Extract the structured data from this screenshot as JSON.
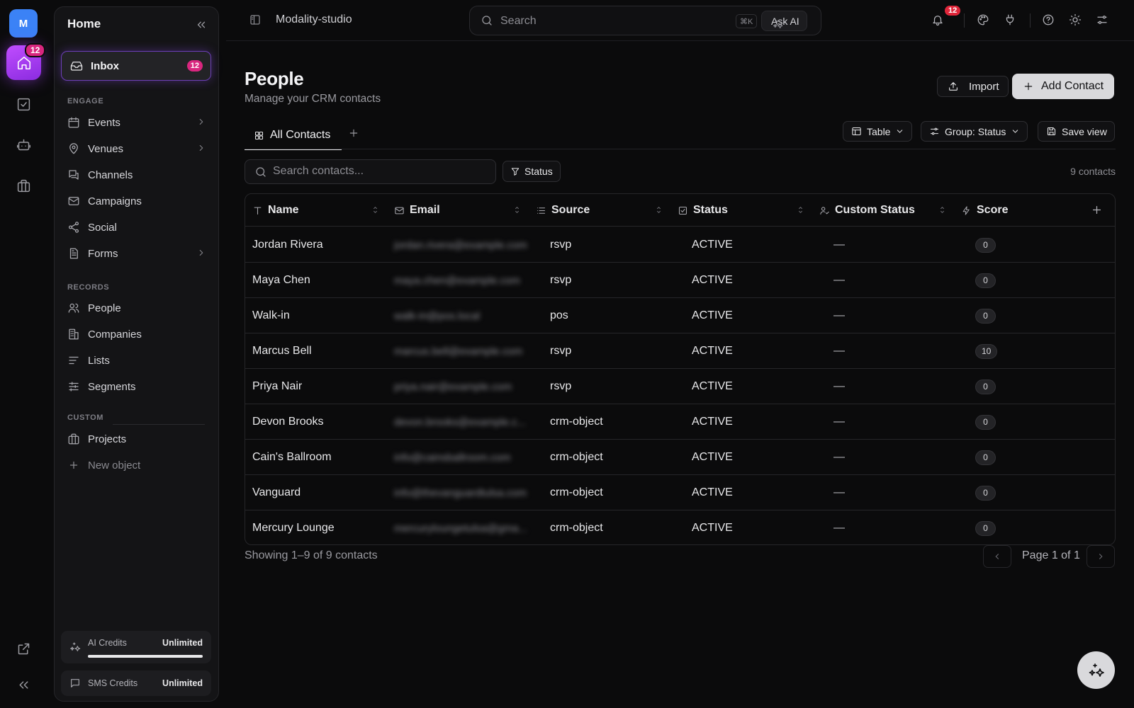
{
  "rail": {
    "avatar_letter": "M",
    "home_badge": "12",
    "icons": [
      "home-icon",
      "tasks-check-icon",
      "bot-icon",
      "briefcase-icon",
      "external-link-icon",
      "collapse-double-chevron-icon"
    ]
  },
  "sidebar": {
    "title": "Home",
    "inbox": {
      "label": "Inbox",
      "badge": "12"
    },
    "sections": {
      "engage": "ENGAGE",
      "records": "RECORDS",
      "custom": "CUSTOM"
    },
    "engage_items": [
      {
        "label": "Events",
        "icon": "calendar-icon",
        "has_chevron": true
      },
      {
        "label": "Venues",
        "icon": "map-pin-icon",
        "has_chevron": true
      },
      {
        "label": "Channels",
        "icon": "chat-icon",
        "has_chevron": false
      },
      {
        "label": "Campaigns",
        "icon": "mail-icon",
        "has_chevron": false
      },
      {
        "label": "Social",
        "icon": "share-icon",
        "has_chevron": false
      },
      {
        "label": "Forms",
        "icon": "form-icon",
        "has_chevron": true
      }
    ],
    "records_items": [
      {
        "label": "People",
        "icon": "users-icon"
      },
      {
        "label": "Companies",
        "icon": "building-icon"
      },
      {
        "label": "Lists",
        "icon": "list-icon"
      },
      {
        "label": "Segments",
        "icon": "sliders-icon"
      }
    ],
    "custom_items": [
      {
        "label": "Projects",
        "icon": "briefcase-icon"
      },
      {
        "label": "New object",
        "icon": "plus-icon"
      }
    ],
    "credits": [
      {
        "label": "AI Credits",
        "value": "Unlimited",
        "fill": 1.0
      },
      {
        "label": "SMS Credits",
        "value": "Unlimited"
      }
    ]
  },
  "topbar": {
    "workspace": "Modality-studio",
    "search_placeholder": "Search",
    "shortcut": "⌘K",
    "ask_ai": "Ask AI",
    "notification_count": "12"
  },
  "page": {
    "title": "People",
    "subtitle": "Manage your CRM contacts",
    "import_label": "Import",
    "add_label": "Add Contact",
    "tab_all": "All Contacts",
    "view_table": "Table",
    "view_group": "Group: Status",
    "view_save": "Save view",
    "search_placeholder": "Search contacts...",
    "filter_status": "Status",
    "count": "9 contacts"
  },
  "table": {
    "columns": [
      {
        "label": "Name",
        "icon": "text-type-icon"
      },
      {
        "label": "Email",
        "icon": "mail-icon"
      },
      {
        "label": "Source",
        "icon": "list-icon"
      },
      {
        "label": "Status",
        "icon": "checkbox-icon"
      },
      {
        "label": "Custom Status",
        "icon": "user-check-icon"
      },
      {
        "label": "Score",
        "icon": "bolt-icon"
      }
    ],
    "rows": [
      {
        "name": "Jordan Rivera",
        "email": "jordan.rivera@example.com",
        "source": "rsvp",
        "status": "ACTIVE",
        "custom": "—",
        "score": "0"
      },
      {
        "name": "Maya Chen",
        "email": "maya.chen@example.com",
        "source": "rsvp",
        "status": "ACTIVE",
        "custom": "—",
        "score": "0"
      },
      {
        "name": "Walk-in",
        "email": "walk-in@pos.local",
        "source": "pos",
        "status": "ACTIVE",
        "custom": "—",
        "score": "0"
      },
      {
        "name": "Marcus Bell",
        "email": "marcus.bell@example.com",
        "source": "rsvp",
        "status": "ACTIVE",
        "custom": "—",
        "score": "10"
      },
      {
        "name": "Priya Nair",
        "email": "priya.nair@example.com",
        "source": "rsvp",
        "status": "ACTIVE",
        "custom": "—",
        "score": "0"
      },
      {
        "name": "Devon Brooks",
        "email": "devon.brooks@example.c...",
        "source": "crm-object",
        "status": "ACTIVE",
        "custom": "—",
        "score": "0"
      },
      {
        "name": "Cain's Ballroom",
        "email": "info@cainsballroom.com",
        "source": "crm-object",
        "status": "ACTIVE",
        "custom": "—",
        "score": "0"
      },
      {
        "name": "Vanguard",
        "email": "info@thevanguardtulsa.com",
        "source": "crm-object",
        "status": "ACTIVE",
        "custom": "—",
        "score": "0"
      },
      {
        "name": "Mercury Lounge",
        "email": "mercuryloungetulsa@gma...",
        "source": "crm-object",
        "status": "ACTIVE",
        "custom": "—",
        "score": "0"
      }
    ]
  },
  "footer": {
    "showing": "Showing 1–9 of 9 contacts",
    "page_label": "Page 1 of 1"
  }
}
